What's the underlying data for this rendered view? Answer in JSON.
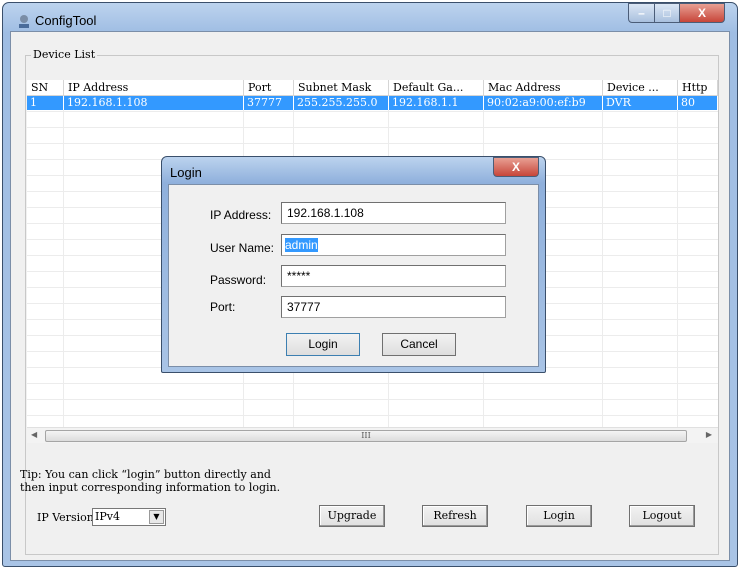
{
  "window": {
    "title": "ConfigTool",
    "controls": {
      "minimize": "–",
      "maximize": "□",
      "close": "X"
    }
  },
  "device_list": {
    "label": "Device List",
    "columns": [
      "SN",
      "IP Address",
      "Port",
      "Subnet Mask",
      "Default Ga...",
      "Mac Address",
      "Device ...",
      "Http"
    ],
    "rows": [
      [
        "1",
        "192.168.1.108",
        "37777",
        "255.255.255.0",
        "192.168.1.1",
        "90:02:a9:00:ef:b9",
        "DVR",
        "80"
      ]
    ],
    "scrollbar_grip": "III"
  },
  "tip": {
    "line1": "Tip: You can click “login” button directly and",
    "line2": "then input corresponding information to login."
  },
  "bottom": {
    "ip_version_label": "IP Version:",
    "ip_version_value": "IPv4",
    "upgrade": "Upgrade",
    "refresh": "Refresh",
    "login": "Login",
    "logout": "Logout"
  },
  "login_dialog": {
    "title": "Login",
    "close": "X",
    "ip_label": "IP Address:",
    "ip_value": "192.168.1.108",
    "user_label": "User Name:",
    "user_value": "admin",
    "password_label": "Password:",
    "password_value": "*****",
    "port_label": "Port:",
    "port_value": "37777",
    "login": "Login",
    "cancel": "Cancel"
  },
  "colors": {
    "selection": "#3399ff",
    "close_button": "#c7463a"
  }
}
